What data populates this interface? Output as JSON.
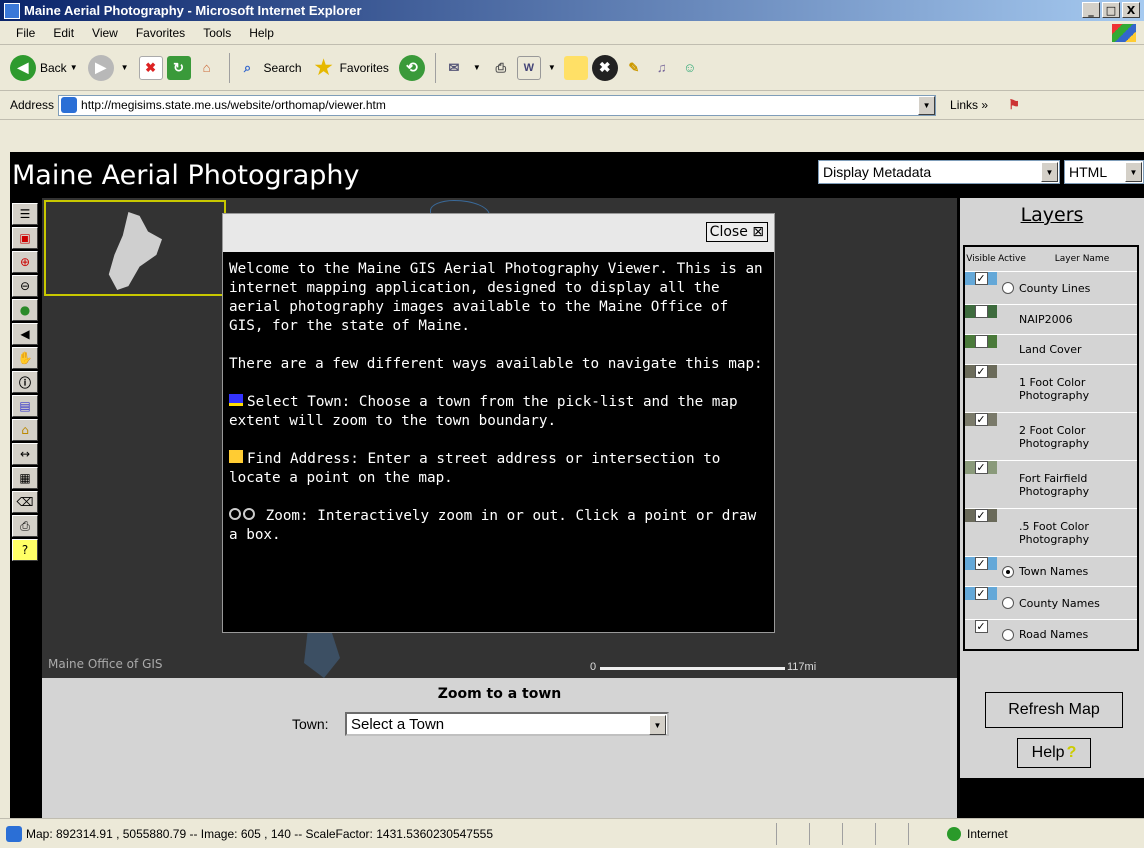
{
  "window": {
    "title": "Maine Aerial Photography - Microsoft Internet Explorer",
    "min": "_",
    "max": "□",
    "close": "X"
  },
  "menu": [
    "File",
    "Edit",
    "View",
    "Favorites",
    "Tools",
    "Help"
  ],
  "toolbar": {
    "back": "Back",
    "search": "Search",
    "favorites": "Favorites"
  },
  "address": {
    "label": "Address",
    "url": "http://megisims.state.me.us/website/orthomap/viewer.htm",
    "links": "Links"
  },
  "page": {
    "title": "Maine Aerial Photography",
    "metadata_select": "Display Metadata",
    "format_select": "HTML"
  },
  "map": {
    "credit": "Maine Office of GIS",
    "scale_start": "0",
    "scale_end": "117mi"
  },
  "dialog": {
    "close_label": "Close ⊠",
    "intro": "Welcome to the Maine GIS Aerial Photography Viewer. This is an internet mapping application, designed to display all the aerial photography images available to the Maine Office of GIS, for the state of Maine.",
    "ways": "There are a few different ways available to navigate this map:",
    "select_town": "Select Town: Choose a town from the pick-list and the map extent will zoom to the town boundary.",
    "find_address": "Find Address: Enter a street address or intersection to locate a point on the map.",
    "zoom": "Zoom: Interactively zoom in or out. Click a point or draw a box."
  },
  "zoom_panel": {
    "title": "Zoom to a town",
    "town_label": "Town:",
    "town_value": "Select a Town"
  },
  "layers": {
    "title": "Layers",
    "headers": [
      "Visible",
      "Active",
      "Layer Name"
    ],
    "rows": [
      {
        "name": "County Lines",
        "visible": true,
        "radio": "off",
        "bg": "#64a8d8"
      },
      {
        "name": "NAIP2006",
        "visible": false,
        "radio": "none",
        "bg": "#3d6b3d"
      },
      {
        "name": "Land Cover",
        "visible": false,
        "radio": "none",
        "bg": "#4a7a3a"
      },
      {
        "name": "1 Foot Color Photography",
        "visible": true,
        "radio": "none",
        "bg": "#6b6b5a"
      },
      {
        "name": "2 Foot Color Photography",
        "visible": true,
        "radio": "none",
        "bg": "#7a7a6a"
      },
      {
        "name": "Fort Fairfield Photography",
        "visible": true,
        "radio": "none",
        "bg": "#8a9a7a"
      },
      {
        "name": ".5 Foot Color Photography",
        "visible": true,
        "radio": "none",
        "bg": "#6a6a5a"
      },
      {
        "name": "Town Names",
        "visible": true,
        "radio": "on",
        "bg": "#64a8d8"
      },
      {
        "name": "County Names",
        "visible": true,
        "radio": "off",
        "bg": "#64a8d8"
      },
      {
        "name": "Road Names",
        "visible": true,
        "radio": "off",
        "bg": "#d4d4d4"
      }
    ],
    "refresh": "Refresh Map",
    "help": "Help"
  },
  "statusbar": {
    "text": "Map: 892314.91 , 5055880.79 -- Image: 605 , 140 -- ScaleFactor: 1431.5360230547555",
    "zone": "Internet"
  }
}
